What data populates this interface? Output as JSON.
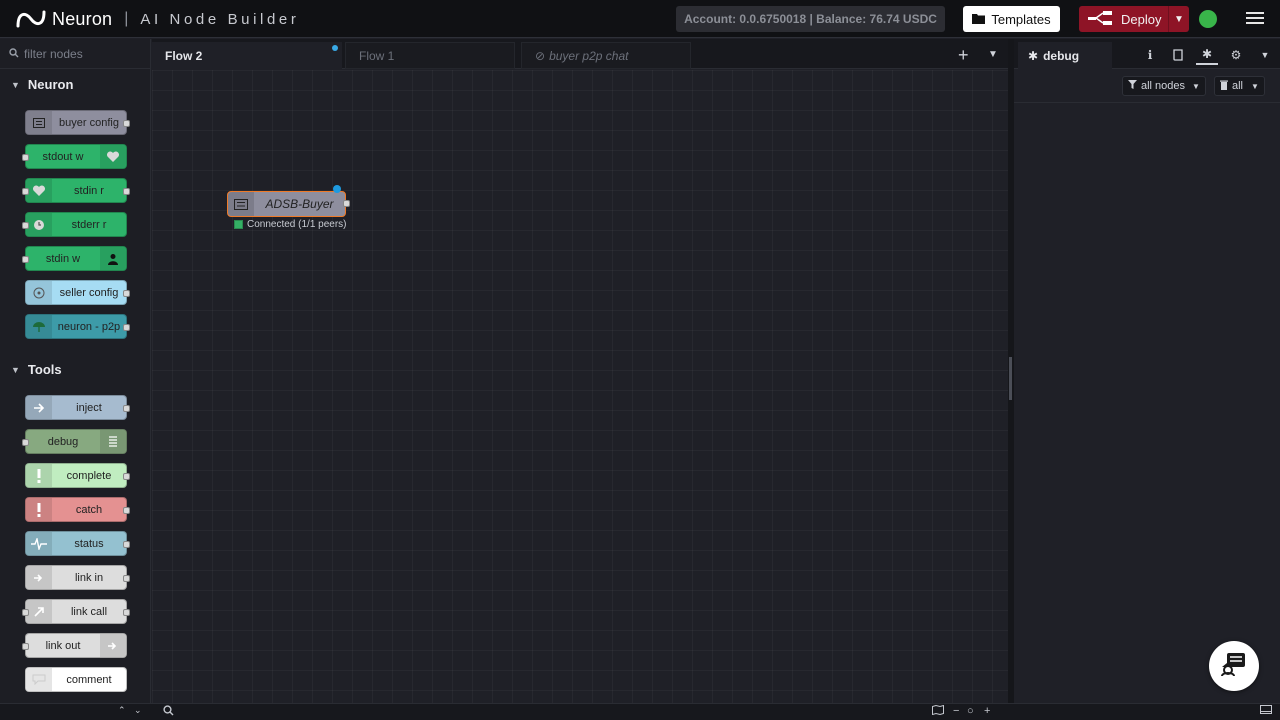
{
  "header": {
    "brand": "Neuron",
    "subtitle": "AI Node Builder",
    "account": "Account: 0.0.6750018 | Balance: 76.74 USDC",
    "templates_label": "Templates",
    "deploy_label": "Deploy",
    "status_color": "#39b54a"
  },
  "palette": {
    "filter_placeholder": "filter nodes",
    "categories": [
      {
        "name": "Neuron",
        "nodes": [
          {
            "label": "buyer config",
            "color": "#8e8e9e",
            "icon": "list-icon"
          },
          {
            "label": "stdout w",
            "color": "#2db36a",
            "icon": "heart-icon"
          },
          {
            "label": "stdin r",
            "color": "#2db36a",
            "icon": "heart-icon"
          },
          {
            "label": "stderr r",
            "color": "#2db36a",
            "icon": "clock-icon"
          },
          {
            "label": "stdin w",
            "color": "#2db36a",
            "icon": "user-icon"
          },
          {
            "label": "seller config",
            "color": "#a6dcf3",
            "icon": "compass-icon"
          },
          {
            "label": "neuron - p2p",
            "color": "#3d9ba8",
            "icon": "umbrella-icon"
          }
        ]
      },
      {
        "name": "Tools",
        "nodes": [
          {
            "label": "inject",
            "color": "#a6bbcf",
            "icon": "arrow-in-icon"
          },
          {
            "label": "debug",
            "color": "#87a980",
            "icon": "list-icon"
          },
          {
            "label": "complete",
            "color": "#c0edc0",
            "icon": "exclamation-icon"
          },
          {
            "label": "catch",
            "color": "#e49191",
            "icon": "exclamation-icon"
          },
          {
            "label": "status",
            "color": "#94c1d0",
            "icon": "pulse-icon"
          },
          {
            "label": "link in",
            "color": "#dddddd",
            "icon": "link-icon"
          },
          {
            "label": "link call",
            "color": "#dddddd",
            "icon": "link-icon"
          },
          {
            "label": "link out",
            "color": "#dddddd",
            "icon": "link-icon"
          },
          {
            "label": "comment",
            "color": "#ffffff",
            "icon": "comment-icon"
          }
        ]
      }
    ]
  },
  "workspace": {
    "tabs": [
      "Flow 2",
      "Flow 1",
      "buyer p2p chat"
    ],
    "node": {
      "label": "ADSB-Buyer",
      "status": "Connected (1/1 peers)"
    }
  },
  "sidebar": {
    "tab_label": "debug",
    "filter_label": "all nodes",
    "clear_label": "all"
  }
}
